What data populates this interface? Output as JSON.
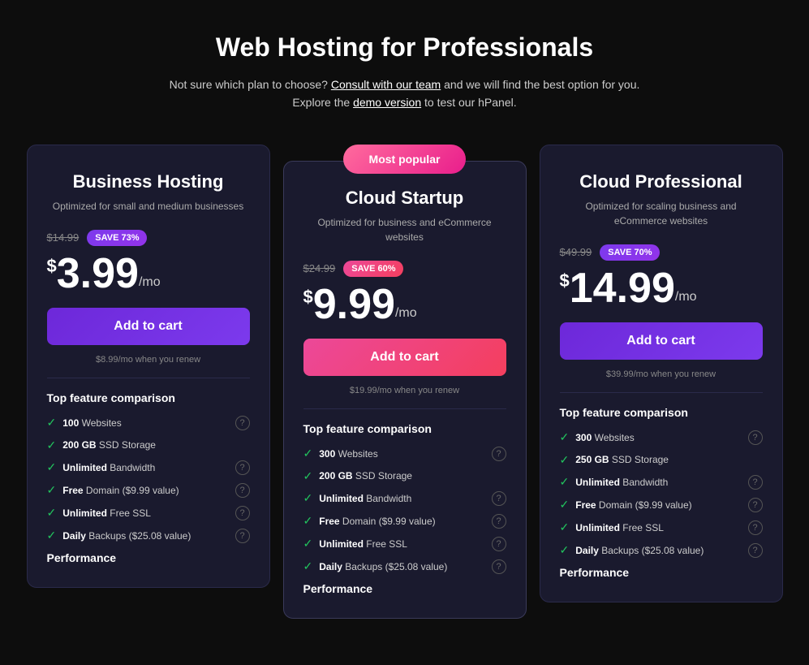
{
  "header": {
    "title": "Web Hosting for Professionals",
    "description1": "Not sure which plan to choose?",
    "link1": "Consult with our team",
    "description2": " and we will find the best option for you.",
    "description3": "Explore the ",
    "link2": "demo version",
    "description4": " to test our hPanel."
  },
  "plans": [
    {
      "id": "business",
      "popular": false,
      "badge": "",
      "title": "Business Hosting",
      "subtitle": "Optimized for small and medium businesses",
      "original_price": "$14.99",
      "save_label": "SAVE 73%",
      "save_style": "purple",
      "price_dollar": "$",
      "price_amount": "3.99",
      "price_period": "/mo",
      "btn_label": "Add to cart",
      "btn_style": "purple",
      "renew_text": "$8.99/mo when you renew",
      "features_title": "Top feature comparison",
      "features": [
        {
          "text": "100 Websites",
          "bold": "100",
          "info": true
        },
        {
          "text": "200 GB SSD Storage",
          "bold": "200 GB",
          "info": false
        },
        {
          "text": "Unlimited Bandwidth",
          "bold": "Unlimited",
          "info": true
        },
        {
          "text": "Free Domain ($9.99 value)",
          "bold": "Free",
          "info": true
        },
        {
          "text": "Unlimited Free SSL",
          "bold": "Unlimited",
          "info": true
        },
        {
          "text": "Daily Backups ($25.08 value)",
          "bold": "Daily",
          "info": true
        }
      ],
      "performance_title": "Performance"
    },
    {
      "id": "cloud-startup",
      "popular": true,
      "badge": "Most popular",
      "title": "Cloud Startup",
      "subtitle": "Optimized for business and eCommerce websites",
      "original_price": "$24.99",
      "save_label": "SAVE 60%",
      "save_style": "pink",
      "price_dollar": "$",
      "price_amount": "9.99",
      "price_period": "/mo",
      "btn_label": "Add to cart",
      "btn_style": "pink",
      "renew_text": "$19.99/mo when you renew",
      "features_title": "Top feature comparison",
      "features": [
        {
          "text": "300 Websites",
          "bold": "300",
          "info": true
        },
        {
          "text": "200 GB SSD Storage",
          "bold": "200 GB",
          "info": false
        },
        {
          "text": "Unlimited Bandwidth",
          "bold": "Unlimited",
          "info": true
        },
        {
          "text": "Free Domain ($9.99 value)",
          "bold": "Free",
          "info": true
        },
        {
          "text": "Unlimited Free SSL",
          "bold": "Unlimited",
          "info": true
        },
        {
          "text": "Daily Backups ($25.08 value)",
          "bold": "Daily",
          "info": true
        }
      ],
      "performance_title": "Performance"
    },
    {
      "id": "cloud-professional",
      "popular": false,
      "badge": "",
      "title": "Cloud Professional",
      "subtitle": "Optimized for scaling business and eCommerce websites",
      "original_price": "$49.99",
      "save_label": "SAVE 70%",
      "save_style": "purple",
      "price_dollar": "$",
      "price_amount": "14.99",
      "price_period": "/mo",
      "btn_label": "Add to cart",
      "btn_style": "purple",
      "renew_text": "$39.99/mo when you renew",
      "features_title": "Top feature comparison",
      "features": [
        {
          "text": "300 Websites",
          "bold": "300",
          "info": true
        },
        {
          "text": "250 GB SSD Storage",
          "bold": "250 GB",
          "info": false
        },
        {
          "text": "Unlimited Bandwidth",
          "bold": "Unlimited",
          "info": true
        },
        {
          "text": "Free Domain ($9.99 value)",
          "bold": "Free",
          "info": true
        },
        {
          "text": "Unlimited Free SSL",
          "bold": "Unlimited",
          "info": true
        },
        {
          "text": "Daily Backups ($25.08 value)",
          "bold": "Daily",
          "info": true
        }
      ],
      "performance_title": "Performance"
    }
  ]
}
